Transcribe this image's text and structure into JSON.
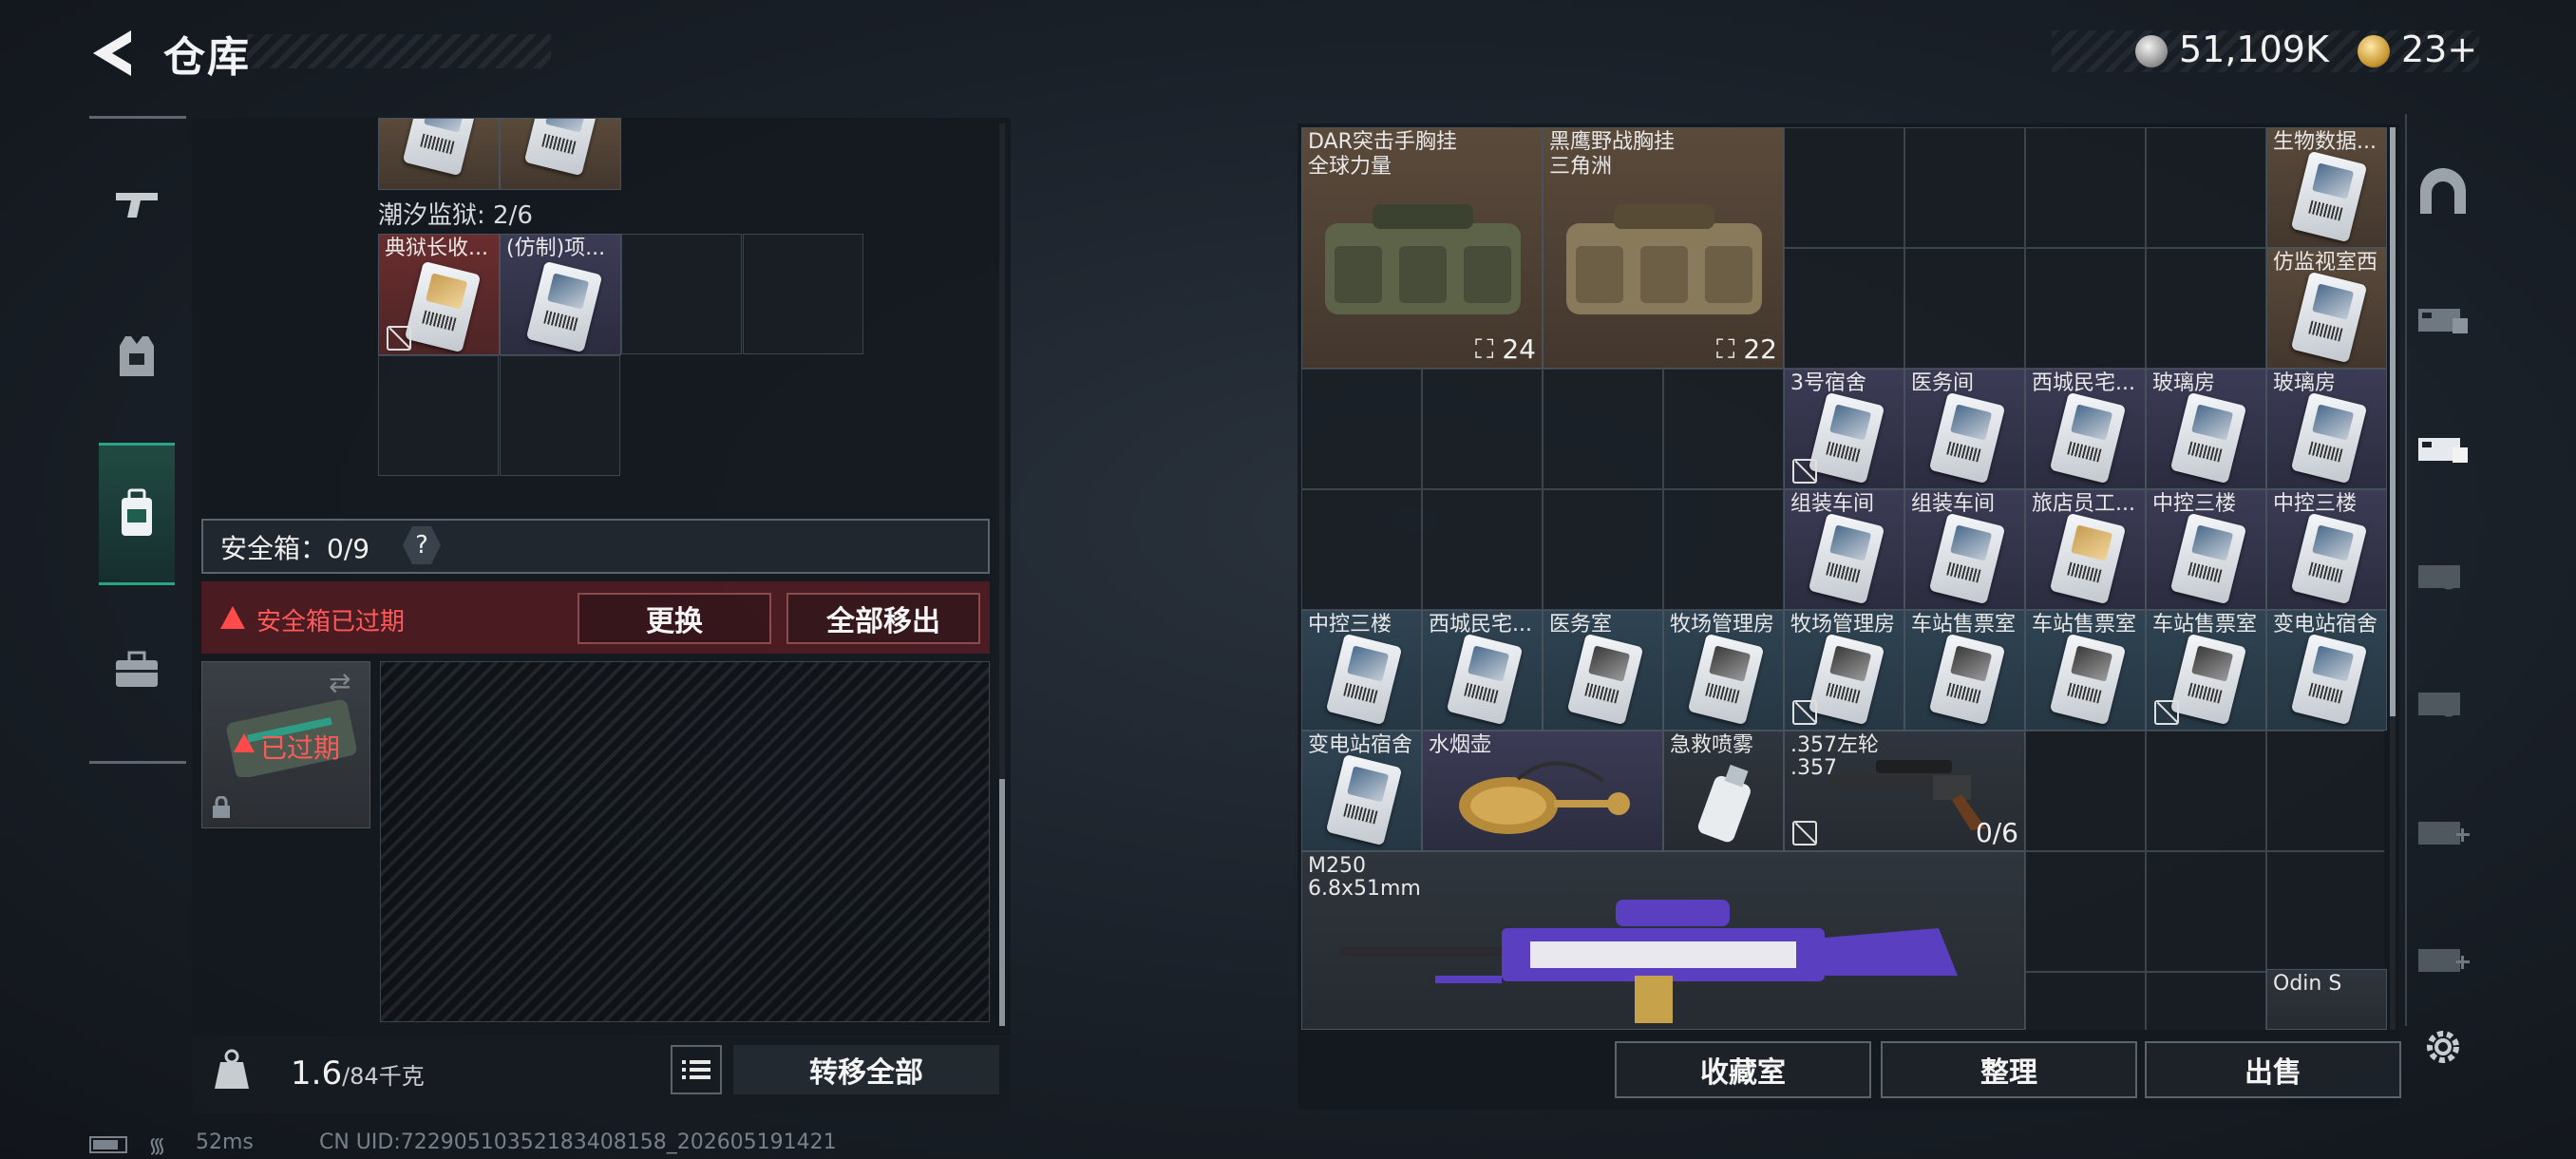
{
  "header": {
    "title": "仓库",
    "silver_amount": "51,109K",
    "gold_amount": "23+"
  },
  "left": {
    "top_items": [
      {
        "label": ""
      },
      {
        "label": ""
      }
    ],
    "section_label": "潮汐监狱: 2/6",
    "section_items": [
      {
        "label": "典狱长收..."
      },
      {
        "label": "(仿制)项..."
      }
    ],
    "safe_box_label": "安全箱：0/9",
    "help_label": "?",
    "expired_warning": "安全箱已过期",
    "replace_button": "更换",
    "move_all_out_button": "全部移出",
    "safebox_status": "已过期",
    "weight_current": "1.6",
    "weight_max": "/84千克",
    "transfer_all_button": "转移全部"
  },
  "stash": {
    "bags": [
      {
        "name_line1": "DAR突击手胸挂",
        "name_line2": "全球力量",
        "count": "24"
      },
      {
        "name_line1": "黑鹰野战胸挂",
        "name_line2": "三角洲",
        "count": "22"
      }
    ],
    "right_column": [
      {
        "label": "生物数据..."
      },
      {
        "label": "仿监视室西"
      }
    ],
    "row2": [
      {
        "label": "3号宿舍"
      },
      {
        "label": "医务间"
      },
      {
        "label": "西城民宅..."
      },
      {
        "label": "玻璃房"
      },
      {
        "label": "玻璃房"
      }
    ],
    "row3": [
      {
        "label": "组装车间"
      },
      {
        "label": "组装车间"
      },
      {
        "label": "旅店员工..."
      },
      {
        "label": "中控三楼"
      },
      {
        "label": "中控三楼"
      }
    ],
    "row4": [
      {
        "label": "中控三楼"
      },
      {
        "label": "西城民宅..."
      },
      {
        "label": "医务室"
      },
      {
        "label": "牧场管理房"
      },
      {
        "label": "牧场管理房"
      },
      {
        "label": "车站售票室"
      },
      {
        "label": "车站售票室"
      },
      {
        "label": "车站售票室"
      },
      {
        "label": "变电站宿舍"
      }
    ],
    "row5": [
      {
        "label": "变电站宿舍"
      },
      {
        "label": "水烟壶"
      },
      {
        "label": "急救喷雾"
      }
    ],
    "revolver": {
      "name_line1": ".357左轮",
      "name_line2": ".357",
      "ammo": "0/6"
    },
    "mg": {
      "name_line1": "M250",
      "name_line2": "6.8x51mm"
    },
    "odin_label": "Odin S",
    "buttons": {
      "collection": "收藏室",
      "sort": "整理",
      "sell": "出售"
    }
  },
  "status": {
    "ping": "52ms",
    "uid": "CN UID:7229051035218340815​8_202605191421"
  }
}
